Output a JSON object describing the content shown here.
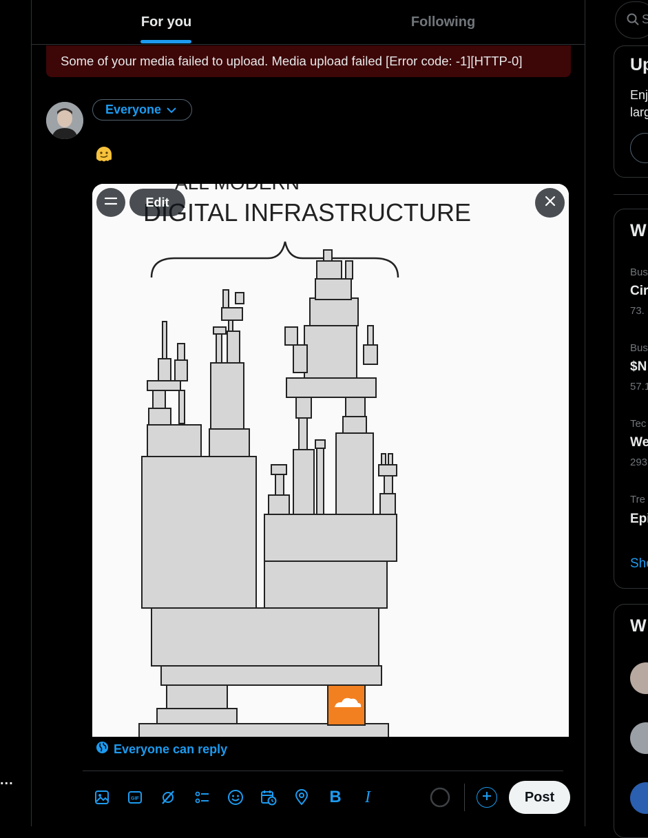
{
  "tabs": {
    "for_you": "For you",
    "following": "Following"
  },
  "error_banner": "Some of your media failed to upload. Media upload failed [Error code: -1][HTTP-0]",
  "composer": {
    "audience": "Everyone",
    "emoji": "🫠",
    "reply_setting": "Everyone can reply",
    "post_button": "Post"
  },
  "media": {
    "edit_label": "Edit",
    "caption_lines": [
      "ALL MODERN",
      "DIGITAL INFRASTRUCTURE"
    ]
  },
  "toolbar": {
    "icons": [
      "image-icon",
      "gif-icon",
      "grok-icon",
      "poll-icon",
      "emoji-icon",
      "schedule-icon",
      "location-icon",
      "bold-icon",
      "italic-icon"
    ],
    "gif_label": "GIF",
    "bold_label": "B",
    "italic_label": "I"
  },
  "left_edge": {
    "more": "..."
  },
  "sidebar": {
    "search_stub": "S",
    "premium": {
      "title": "Up",
      "body_1": "Enj",
      "body_2": "larg"
    },
    "trends": {
      "title": "W",
      "items": [
        {
          "context": "Bus",
          "name": "Cir",
          "meta": "73."
        },
        {
          "context": "Bus",
          "name": "$N",
          "meta": "57.1"
        },
        {
          "context": "Tec",
          "name": "We",
          "meta": "293"
        },
        {
          "context": "Tre",
          "name": "Epi",
          "meta": ""
        }
      ],
      "show_more": "Sho"
    },
    "who_to_follow": {
      "title": "W"
    }
  },
  "colors": {
    "accent": "#1d9bf0",
    "error_bg": "#3d0607",
    "cloudflare": "#f38020"
  }
}
